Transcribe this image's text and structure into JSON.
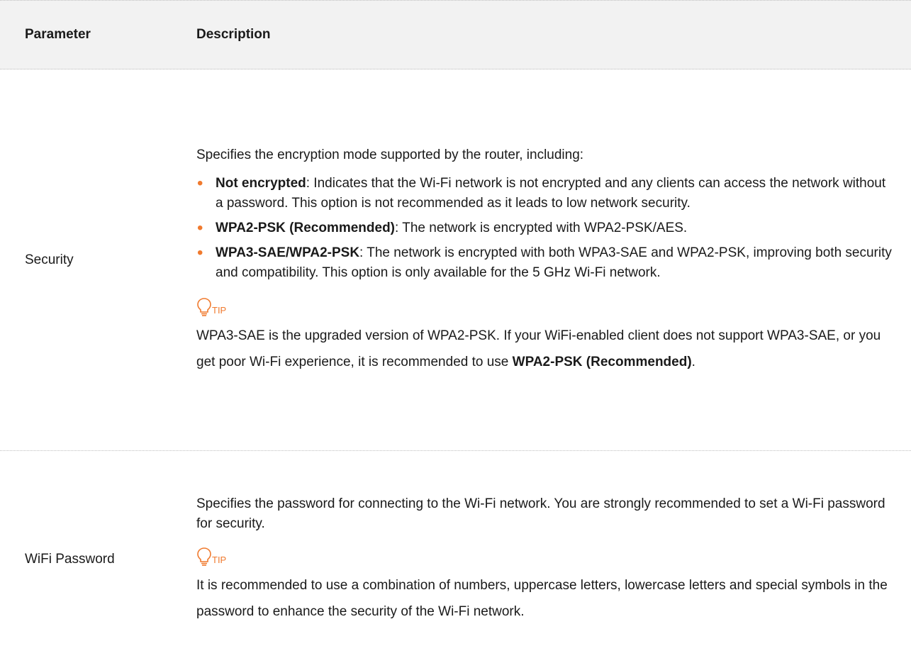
{
  "header": {
    "param": "Parameter",
    "desc": "Description"
  },
  "security": {
    "param": "Security",
    "intro": "Specifies the encryption mode supported by the router, including:",
    "bullets": [
      {
        "term": "Not encrypted",
        "text": ": Indicates that the Wi-Fi network is not encrypted and any clients can access the network without a password. This option is not recommended as it leads to low network security."
      },
      {
        "term": "WPA2-PSK (Recommended)",
        "text": ": The network is encrypted with WPA2-PSK/AES."
      },
      {
        "term": "WPA3-SAE/WPA2-PSK",
        "text": ": The network is encrypted with both WPA3-SAE and WPA2-PSK, improving both security and compatibility. This option is only available for the 5 GHz Wi-Fi network."
      }
    ],
    "tip_label": "TIP",
    "tip_text": "WPA3-SAE is the upgraded version of WPA2-PSK. If your WiFi-enabled client does not support WPA3-SAE, or you get poor Wi-Fi experience, it is recommended to use ",
    "tip_bold": "WPA2-PSK (Recommended)",
    "tip_end": "."
  },
  "password": {
    "param": "WiFi Password",
    "intro": "Specifies the password for connecting to the Wi-Fi network. You are strongly recommended to set a Wi-Fi password for security.",
    "tip_label": "TIP",
    "tip_text": "It is recommended to use a combination of numbers, uppercase letters, lowercase letters and special symbols in the password to enhance the security of the Wi-Fi network."
  },
  "colors": {
    "accent": "#f07a2e",
    "header_bg": "#f2f2f2"
  },
  "icons": {
    "tip": "lightbulb-icon",
    "bullet": "bullet-dot"
  }
}
